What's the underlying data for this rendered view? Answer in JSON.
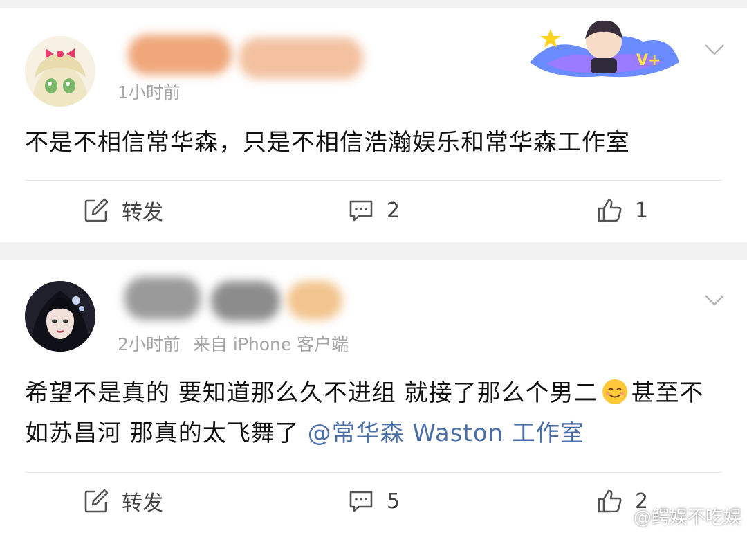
{
  "posts": [
    {
      "time": "1小时前",
      "source": "",
      "content": "不是不相信常华森，只是不相信浩瀚娱乐和常华森工作室",
      "actions": {
        "repost_label": "转发",
        "comment_count": "2",
        "like_count": "1"
      }
    },
    {
      "time": "2小时前",
      "source": "来自 iPhone 客户端",
      "content_before_emoji": "希望不是真的 要知道那么久不进组 就接了那么个男二",
      "content_after_emoji": "甚至不如苏昌河 那真的太飞舞了 ",
      "mention": "@常华森 Waston 工作室",
      "actions": {
        "repost_label": "转发",
        "comment_count": "5",
        "like_count": "2"
      }
    }
  ],
  "watermark": "@鳄娱不吃娱",
  "icons": {
    "repost": "edit-square-icon",
    "comment": "comment-icon",
    "like": "thumbs-up-icon",
    "menu": "chevron-down-icon",
    "emoji": "smiling-face-emoji"
  },
  "colors": {
    "mention": "#4a6ea8",
    "meta": "#a6a6a6",
    "background": "#f2f2f2"
  }
}
